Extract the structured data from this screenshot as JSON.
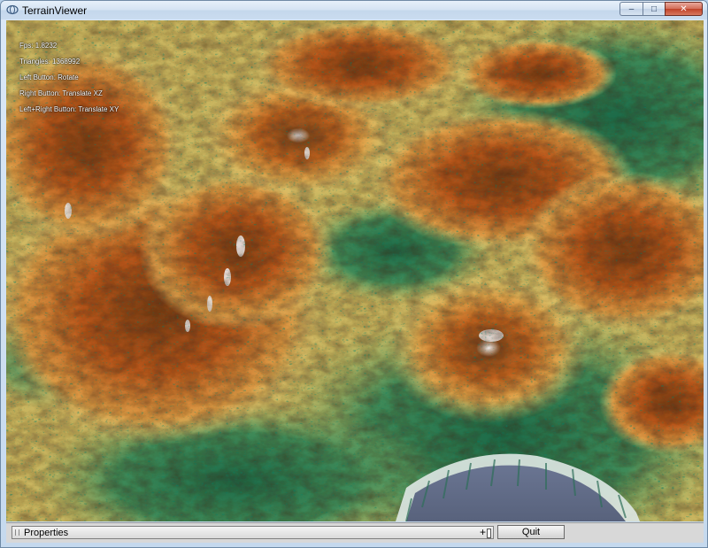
{
  "window": {
    "title": "TerrainViewer",
    "buttons": {
      "minimize": "–",
      "maximize": "□",
      "close": "✕"
    }
  },
  "viewport": {
    "hud": {
      "fps": "Fps: 1.8232",
      "triangles": "Triangles: 1368992",
      "left_button": "Left Button: Rotate",
      "right_button": "Right Button: Translate XZ",
      "both_buttons": "Left+Right Button: Translate XY"
    }
  },
  "bottom_bar": {
    "properties_label": "Properties",
    "expand_symbol": "+",
    "quit_label": "Quit"
  },
  "colors": {
    "lowland": "#1f6b4a",
    "midland": "#e6d27a",
    "highland": "#b4561b",
    "peak": "#f2f2f2",
    "lake": "#5f6a85"
  }
}
